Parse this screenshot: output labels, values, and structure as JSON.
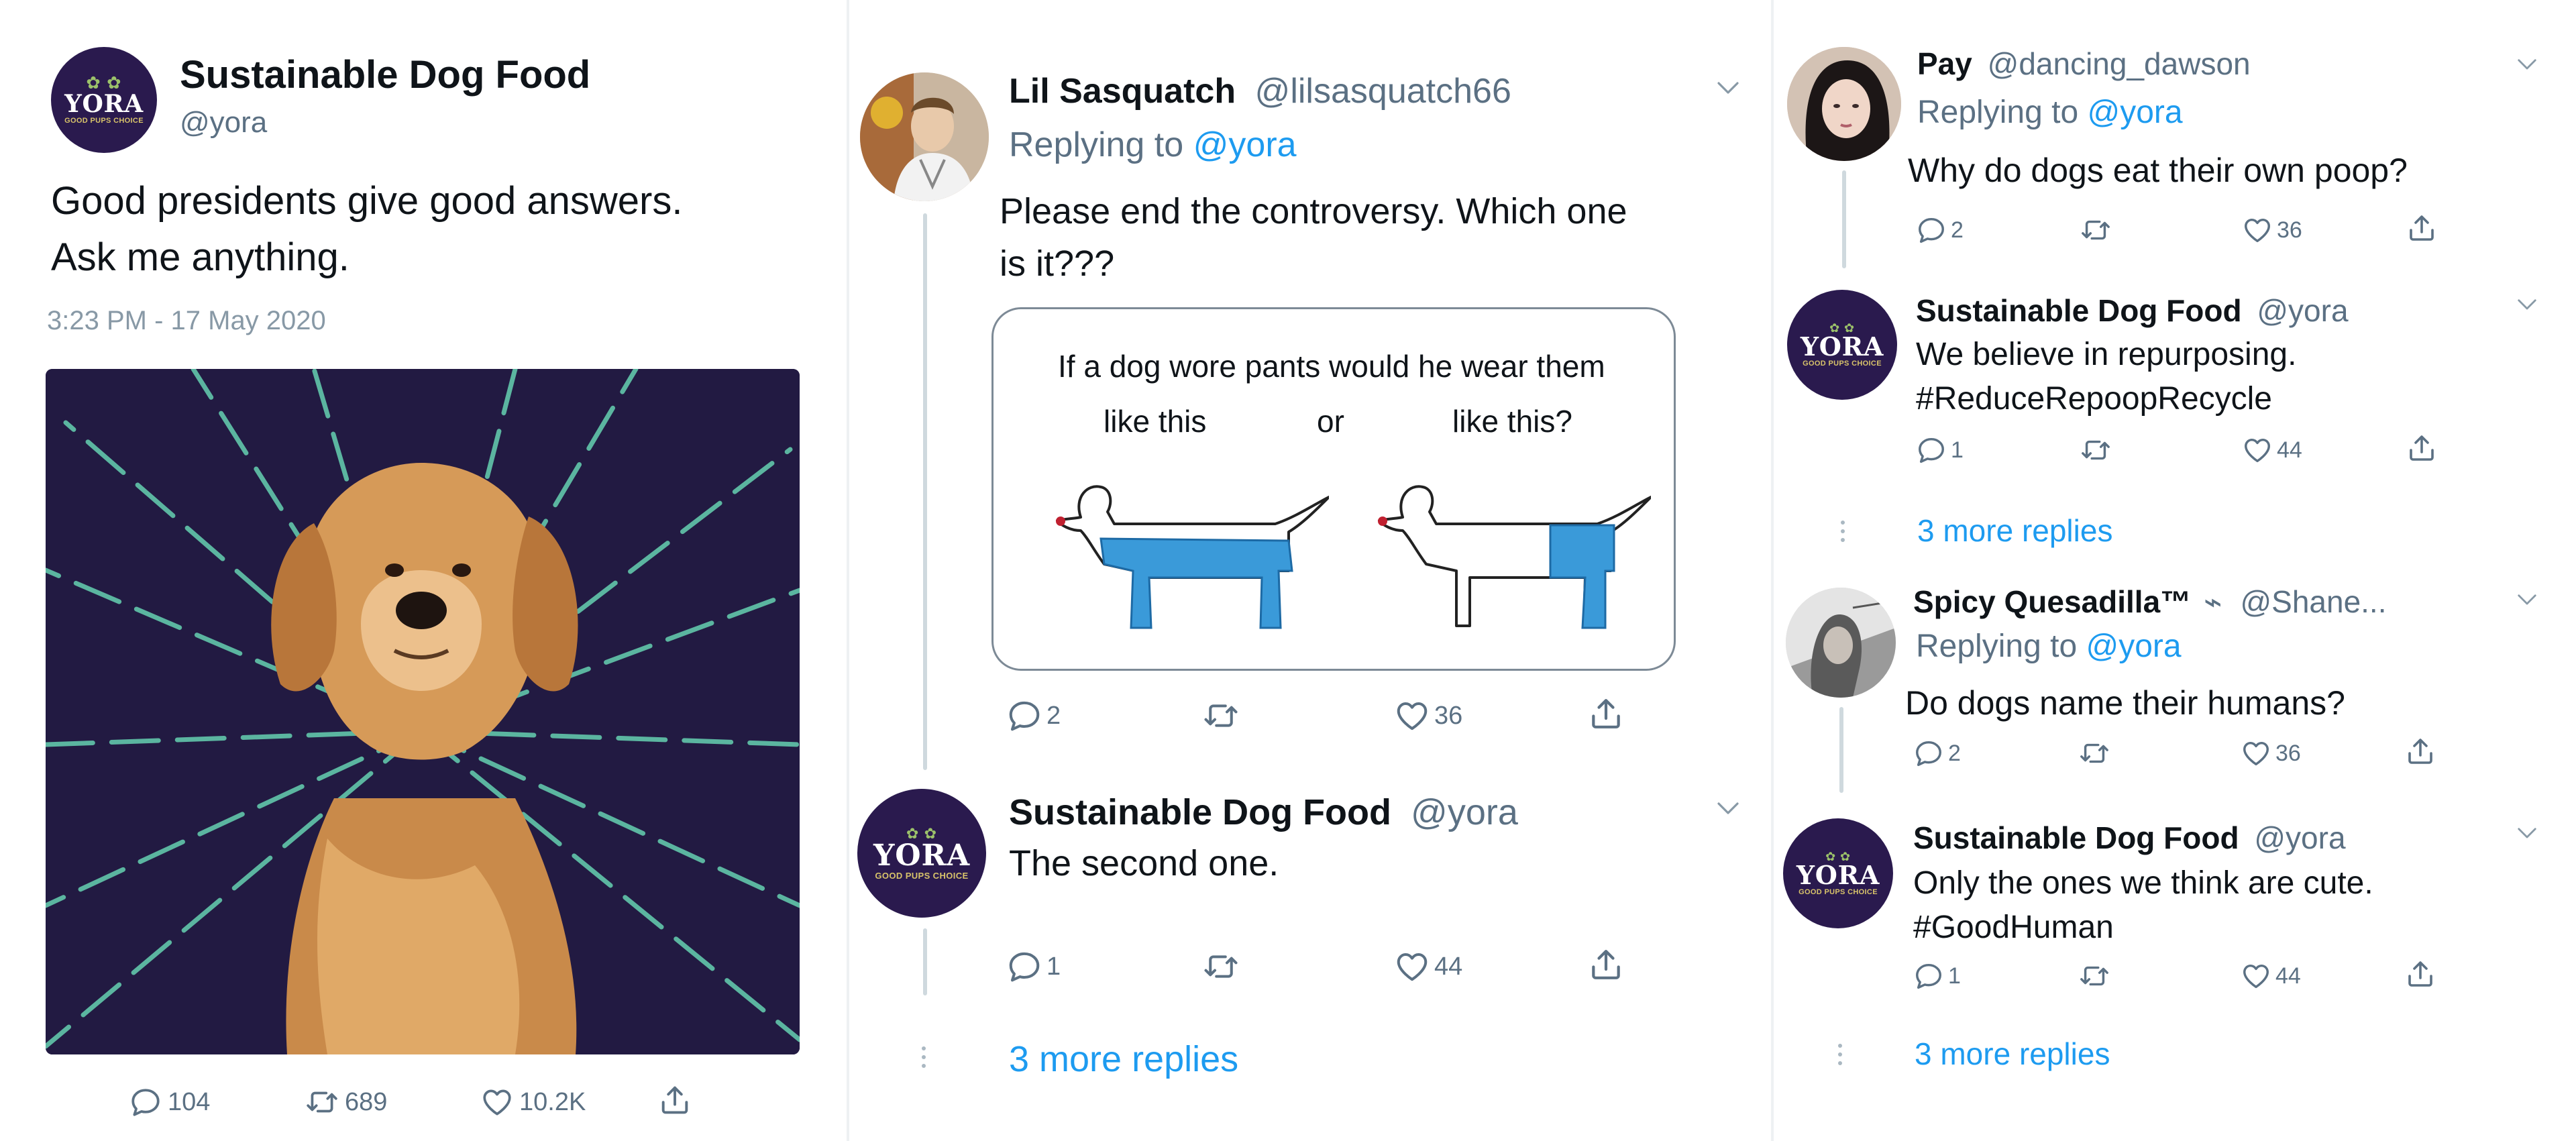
{
  "main_tweet": {
    "author_name": "Sustainable Dog Food",
    "author_handle": "@yora",
    "avatar_word": "YORA",
    "avatar_tagline": "GOOD PUPS CHOICE",
    "text_line1": "Good presidents give good answers.",
    "text_line2": "Ask me anything.",
    "timestamp": "3:23 PM - 17 May 2020",
    "replies": "104",
    "retweets": "689",
    "likes": "10.2K"
  },
  "middle_thread": {
    "question": {
      "author_name": "Lil Sasquatch",
      "author_handle": "@lilsasquatch66",
      "replying_prefix": "Replying to",
      "replying_handle": "@yora",
      "text_line1": "Please end the controversy. Which one",
      "text_line2": "is it???",
      "card": {
        "caption": "If a dog wore pants would he wear them",
        "option_left": "like this",
        "option_mid": "or",
        "option_right": "like this?"
      },
      "replies": "2",
      "likes": "36"
    },
    "answer": {
      "author_name": "Sustainable Dog Food",
      "author_handle": "@yora",
      "text": "The second one.",
      "replies": "1",
      "likes": "44"
    },
    "more_replies": "3 more replies"
  },
  "right_threads": [
    {
      "question": {
        "author_name": "Pay",
        "author_handle": "@dancing_dawson",
        "replying_prefix": "Replying to",
        "replying_handle": "@yora",
        "text": "Why do dogs eat their own poop?",
        "replies": "2",
        "likes": "36"
      },
      "answer": {
        "author_name": "Sustainable Dog Food",
        "author_handle": "@yora",
        "text_line1": "We believe in repurposing.",
        "text_line2": "#ReduceRepoopRecycle",
        "replies": "1",
        "likes": "44"
      },
      "more_replies": "3 more replies"
    },
    {
      "question": {
        "author_name": "Spicy Quesadilla™",
        "author_handle": "@Shane...",
        "replying_prefix": "Replying to",
        "replying_handle": "@yora",
        "text": "Do dogs name their humans?",
        "replies": "2",
        "likes": "36"
      },
      "answer": {
        "author_name": "Sustainable Dog Food",
        "author_handle": "@yora",
        "text_line1": "Only the ones we think are cute.",
        "text_line2": "#GoodHuman",
        "replies": "1",
        "likes": "44"
      },
      "more_replies": "3 more replies"
    }
  ],
  "icons": [
    "reply-icon",
    "retweet-icon",
    "like-icon",
    "share-icon",
    "chevron-down-icon"
  ],
  "colors": {
    "link": "#1d9bf0",
    "muted": "#5b7083",
    "brand_purple": "#2a1a4e",
    "burst_green": "#5bb5a0",
    "pants_blue": "#3a9ad9"
  }
}
